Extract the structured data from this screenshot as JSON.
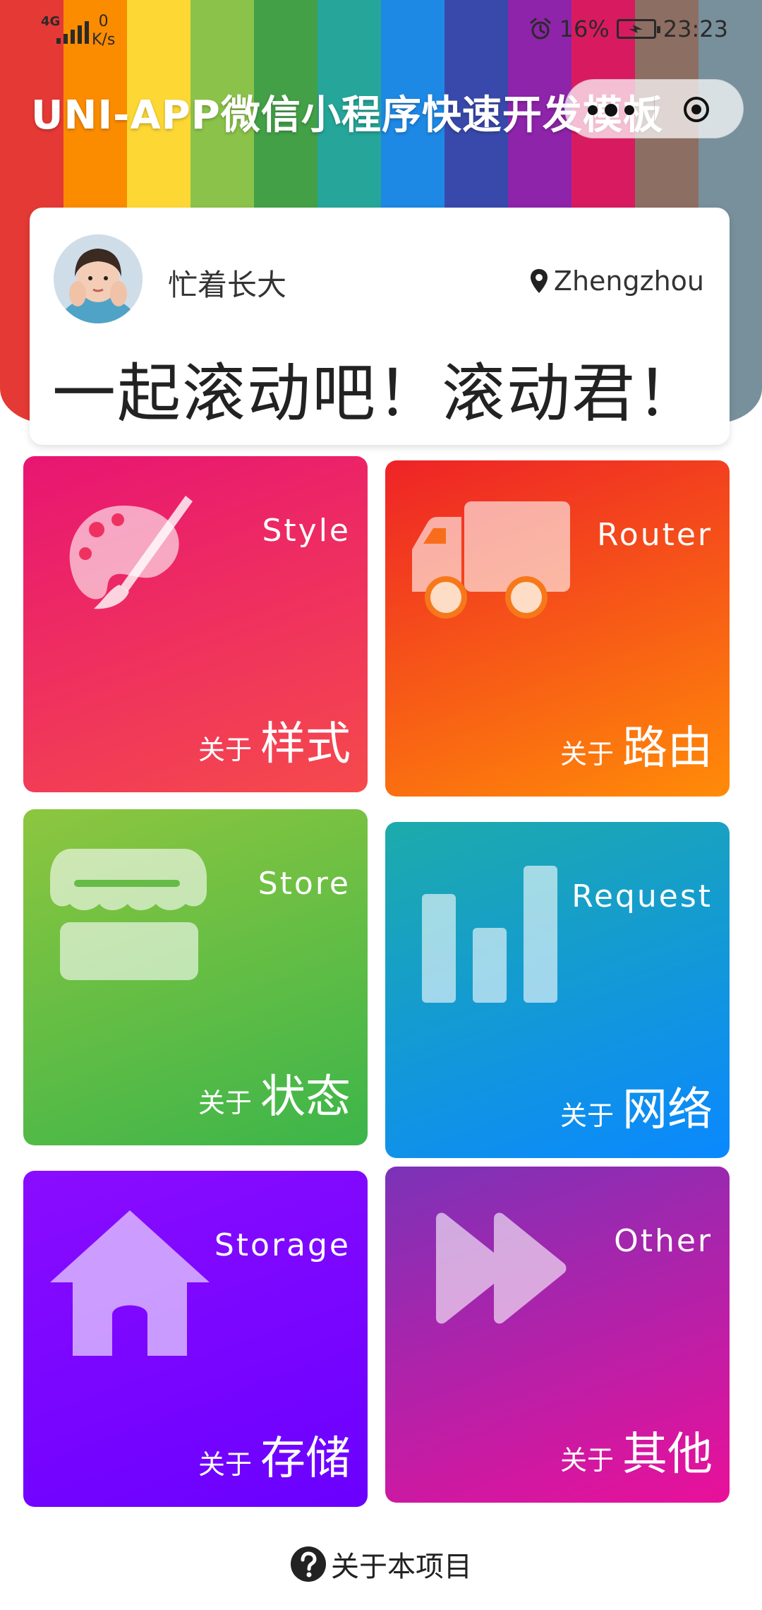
{
  "status_bar": {
    "network": "4G",
    "speed_value": "0",
    "speed_unit": "K/s",
    "battery": "16%",
    "time": "23:23"
  },
  "nav": {
    "title": "UNI-APP微信小程序快速开发模板"
  },
  "header_stripes": [
    "#e53935",
    "#fb8c00",
    "#fdd835",
    "#8bc34a",
    "#43a047",
    "#26a69a",
    "#1e88e5",
    "#3949ab",
    "#8e24aa",
    "#d81b60",
    "#8d6e63",
    "#78909c"
  ],
  "profile": {
    "username": "忙着长大",
    "location": "Zhengzhou",
    "motto": "一起滚动吧！滚动君！"
  },
  "tiles": [
    {
      "en": "Style",
      "prefix": "关于",
      "cn": "样式",
      "icon": "palette-icon",
      "gradient": [
        "#e81572",
        "#f54a4c"
      ]
    },
    {
      "en": "Router",
      "prefix": "关于",
      "cn": "路由",
      "icon": "truck-icon",
      "gradient": [
        "#ee2327",
        "#ff8b08"
      ]
    },
    {
      "en": "Store",
      "prefix": "关于",
      "cn": "状态",
      "icon": "storefront-icon",
      "gradient": [
        "#8dc63f",
        "#3cb54a"
      ]
    },
    {
      "en": "Request",
      "prefix": "关于",
      "cn": "网络",
      "icon": "bar-chart-icon",
      "gradient": [
        "#1dabaa",
        "#0a88ff"
      ]
    },
    {
      "en": "Storage",
      "prefix": "关于",
      "cn": "存储",
      "icon": "home-icon",
      "gradient": [
        "#8a0cff",
        "#6a00ff"
      ]
    },
    {
      "en": "Other",
      "prefix": "关于",
      "cn": "其他",
      "icon": "fast-forward-icon",
      "gradient": [
        "#7b33b8",
        "#e9109a"
      ]
    }
  ],
  "footer": {
    "label": "关于本项目"
  }
}
